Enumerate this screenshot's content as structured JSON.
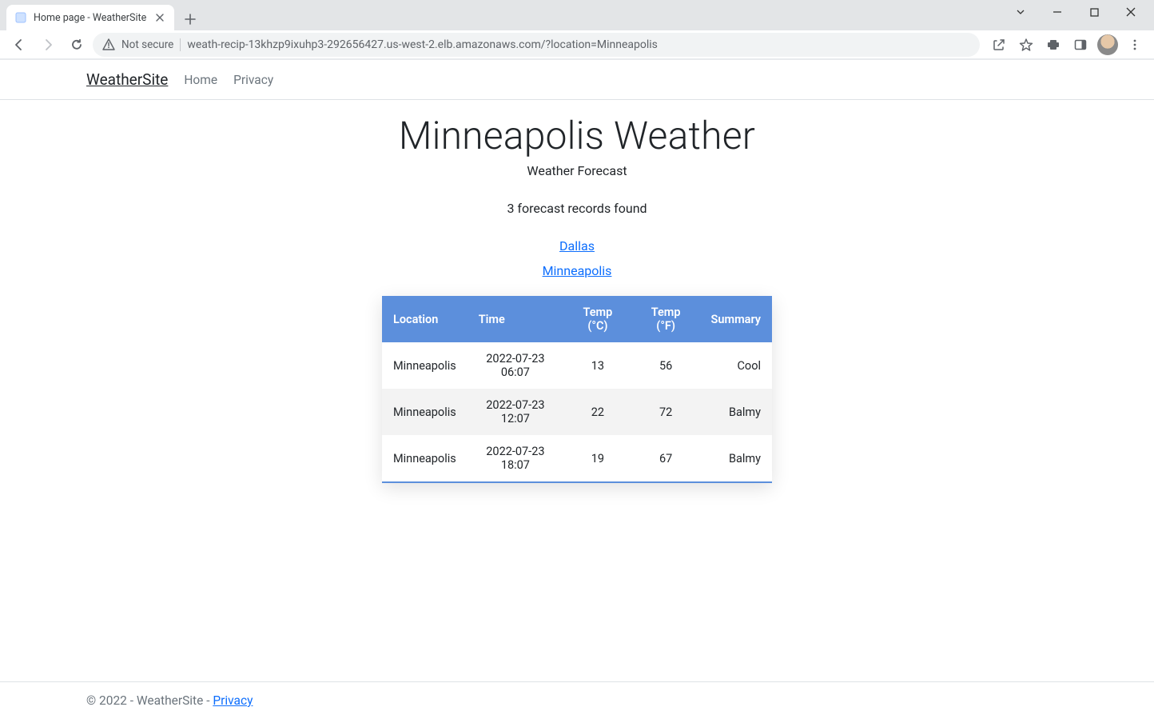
{
  "window": {
    "tab_title": "Home page - WeatherSite",
    "not_secure_label": "Not secure",
    "url": "weath-recip-13khzp9ixuhp3-292656427.us-west-2.elb.amazonaws.com/?location=Minneapolis"
  },
  "nav": {
    "brand": "WeatherSite",
    "links": [
      {
        "label": "Home"
      },
      {
        "label": "Privacy"
      }
    ]
  },
  "page": {
    "heading": "Minneapolis Weather",
    "subtitle": "Weather Forecast",
    "records_found": "3 forecast records found",
    "location_links": [
      {
        "label": "Dallas"
      },
      {
        "label": "Minneapolis"
      }
    ]
  },
  "table": {
    "headers": {
      "location": "Location",
      "time": "Time",
      "temp_c": "Temp (°C)",
      "temp_f": "Temp (°F)",
      "summary": "Summary"
    },
    "rows": [
      {
        "location": "Minneapolis",
        "time": "2022-07-23 06:07",
        "temp_c": "13",
        "temp_f": "56",
        "summary": "Cool"
      },
      {
        "location": "Minneapolis",
        "time": "2022-07-23 12:07",
        "temp_c": "22",
        "temp_f": "72",
        "summary": "Balmy"
      },
      {
        "location": "Minneapolis",
        "time": "2022-07-23 18:07",
        "temp_c": "19",
        "temp_f": "67",
        "summary": "Balmy"
      }
    ]
  },
  "footer": {
    "text": "© 2022 - WeatherSite - ",
    "privacy": "Privacy"
  }
}
